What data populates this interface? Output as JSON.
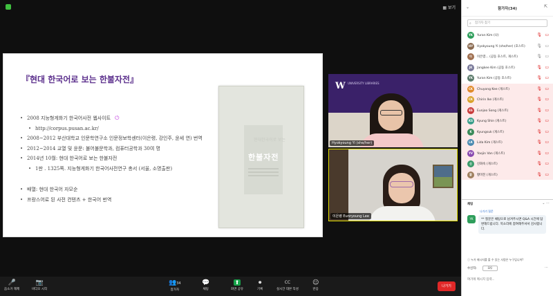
{
  "window": {
    "view_label": "보기"
  },
  "slide": {
    "title": "『현대 한국어로 보는 한불자전』",
    "items": [
      {
        "text": "2008 지능형게화기 한국어사전 웹사이트",
        "level": 1,
        "link_icon": "power-icon"
      },
      {
        "text": "http://corpus.pusan.ac.kr/",
        "level": 2
      },
      {
        "text": "2008~2012 부산대학교 인문학연구소 인문정보학센터(이은령, 강인주, 윤세 연) 번역",
        "level": 1
      },
      {
        "text": "2012~2014 교열 및 윤문: 불어불문학과, 컴퓨터공학과 30여 명",
        "level": 1
      },
      {
        "text": "2014년 10월: 현대 한국어로 보는 한불자전",
        "level": 1
      },
      {
        "text": "1판 . 1325쪽. 지능형게화기 한국어사전연구 총서 (서울, 소명출판)",
        "level": 2
      },
      {
        "text": "",
        "level": 0
      },
      {
        "text": "배열: 현대 한국어 자모순",
        "level": 1
      },
      {
        "text": "프랑스어로 된 사전 컨텐츠 + 한국어 번역",
        "level": 1
      }
    ],
    "book": {
      "title": "한불자전",
      "subtitle": "현대한국어로 보는"
    }
  },
  "videos": [
    {
      "name": "Hyokyoung Yi (she/her)",
      "logo_letter": "W",
      "logo_text": "UNIVERSITY LIBRARIES"
    },
    {
      "name": "이은령 Eunryoung Lee"
    }
  ],
  "toolbar": {
    "items": [
      {
        "icon": "🎤",
        "label": "음소거 해제"
      },
      {
        "icon": "📷",
        "label": "비디오 시작"
      },
      {
        "icon": "👥",
        "label": "참가자"
      },
      {
        "icon": "💬",
        "label": "채팅"
      },
      {
        "icon": "⬆",
        "label": "화면 공유"
      },
      {
        "icon": "⏺",
        "label": "기록"
      },
      {
        "icon": "CC",
        "label": "실시간 대본 작성"
      },
      {
        "icon": "☺",
        "label": "반응"
      }
    ],
    "participants_count": "34",
    "leave_label": "나가기"
  },
  "panel": {
    "title": "참가자(34)",
    "search_placeholder": "참가자 찾기",
    "participants": [
      {
        "initials": "YK",
        "name": "Yuran Kim (나)",
        "color": "#2e9e5b",
        "mic": "muted",
        "cam": "off"
      },
      {
        "initials": "HY",
        "name": "Hyokyoung Yi (she/her) (호스트)",
        "color": "#8a6a50",
        "mic": "on",
        "cam": "on"
      },
      {
        "initials": "이",
        "name": "이은령... (공동 호스트, 게스트)",
        "color": "#a07050",
        "mic": "on",
        "cam": "on"
      },
      {
        "initials": "JK",
        "name": "Jangkee Kim (공동 호스트)",
        "color": "#7a7a9a",
        "mic": "muted",
        "cam": "off"
      },
      {
        "initials": "YK",
        "name": "Yuran Kim (공동 호스트)",
        "color": "#5a7a6a",
        "mic": "muted",
        "cam": "off"
      },
      {
        "initials": "CK",
        "name": "Chuyong Kee (게스트)",
        "color": "#e08a2a",
        "mic": "muted",
        "cam": "off"
      },
      {
        "initials": "CK",
        "name": "Chirin Ike (게스트)",
        "color": "#d9a22a",
        "mic": "muted",
        "cam": "off"
      },
      {
        "initials": "ES",
        "name": "Eunjoo Song (게스트)",
        "color": "#c83a3a",
        "mic": "muted",
        "cam": "off"
      },
      {
        "initials": "KS",
        "name": "Kyung Shin (게스트)",
        "color": "#3a9e8a",
        "mic": "muted",
        "cam": "off"
      },
      {
        "initials": "K",
        "name": "Kyungsuk (게스트)",
        "color": "#3a8a5a",
        "mic": "muted",
        "cam": "off"
      },
      {
        "initials": "LK",
        "name": "Lida Kim (게스트)",
        "color": "#4a8ab0",
        "mic": "muted",
        "cam": "off"
      },
      {
        "initials": "YV",
        "name": "Yoojin Van (게스트)",
        "color": "#8a4ab0",
        "mic": "muted",
        "cam": "off"
      },
      {
        "initials": "신",
        "name": "신화숙 (게스트)",
        "color": "#3a9a6a",
        "mic": "muted",
        "cam": "off"
      },
      {
        "initials": "황",
        "name": "황미진 (게스트)",
        "color": "#a08060",
        "mic": "muted",
        "cam": "off"
      }
    ]
  },
  "chat": {
    "title": "채팅",
    "sender": "나가기 질문",
    "avatar": "YK",
    "message": "** 질문은 채팅으로 남겨주시면 Q&A 시간에 답변해드립니다. 목소리에 참여해주셔서 감사합니다.",
    "notice": "ⓘ 누가 메시지를 볼 수 있는 사람은 누구입니까?",
    "to_label": "수신자:",
    "to_value": "모두",
    "input_placeholder": "여기에 메시지 입력..."
  }
}
